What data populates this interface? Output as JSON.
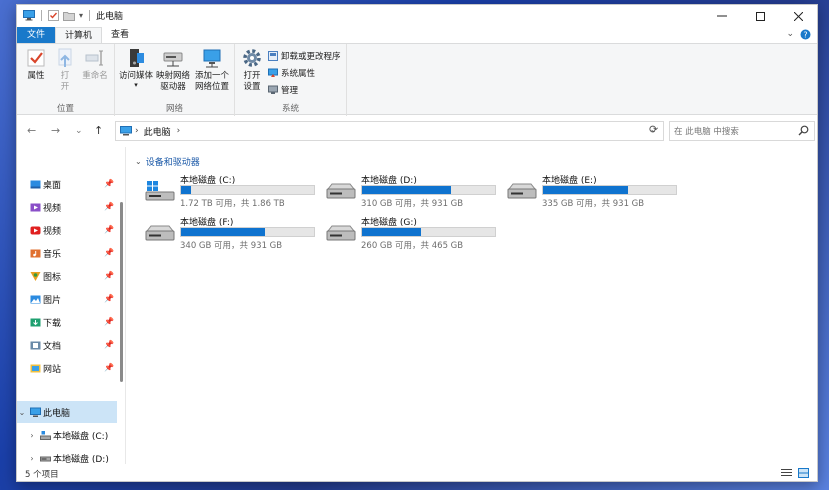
{
  "window": {
    "title": "此电脑"
  },
  "tabs": {
    "file": "文件",
    "computer": "计算机",
    "view": "查看"
  },
  "ribbon": {
    "group_location": {
      "label": "位置",
      "properties": "属性",
      "open_line1": "打",
      "open_line2": "开",
      "rename": "重命名"
    },
    "group_network": {
      "label": "网络",
      "access_media": "访问媒体",
      "map_drive_line1": "映射网络",
      "map_drive_line2": "驱动器",
      "add_location_line1": "添加一个",
      "add_location_line2": "网络位置"
    },
    "group_system": {
      "label": "系统",
      "open_settings_line1": "打开",
      "open_settings_line2": "设置",
      "uninstall": "卸载或更改程序",
      "system_properties": "系统属性",
      "manage": "管理"
    }
  },
  "address": {
    "crumb": "此电脑",
    "search_placeholder": "在 此电脑 中搜索"
  },
  "navpane": {
    "quick_access": [
      {
        "label": "桌面"
      },
      {
        "label": "视频"
      },
      {
        "label": "视频"
      },
      {
        "label": "音乐"
      },
      {
        "label": "图标"
      },
      {
        "label": "图片"
      },
      {
        "label": "下载"
      },
      {
        "label": "文档"
      },
      {
        "label": "网站"
      }
    ],
    "this_pc": "此电脑",
    "drive_c": "本地磁盘 (C:)",
    "drive_d": "本地磁盘 (D:)"
  },
  "main": {
    "group_title": "设备和驱动器",
    "drives": [
      {
        "name": "本地磁盘 (C:)",
        "info": "1.72 TB 可用，共 1.86 TB",
        "used_fraction": 0.075
      },
      {
        "name": "本地磁盘 (D:)",
        "info": "310 GB 可用，共 931 GB",
        "used_fraction": 0.667
      },
      {
        "name": "本地磁盘 (E:)",
        "info": "335 GB 可用，共 931 GB",
        "used_fraction": 0.64
      },
      {
        "name": "本地磁盘 (F:)",
        "info": "340 GB 可用，共 931 GB",
        "used_fraction": 0.635
      },
      {
        "name": "本地磁盘 (G:)",
        "info": "260 GB 可用，共 465 GB",
        "used_fraction": 0.44
      }
    ]
  },
  "status": {
    "count": "5 个项目"
  },
  "colors": {
    "accent": "#1979ca",
    "drive_bar": "#0f73cf",
    "selected": "#cce4f7"
  }
}
